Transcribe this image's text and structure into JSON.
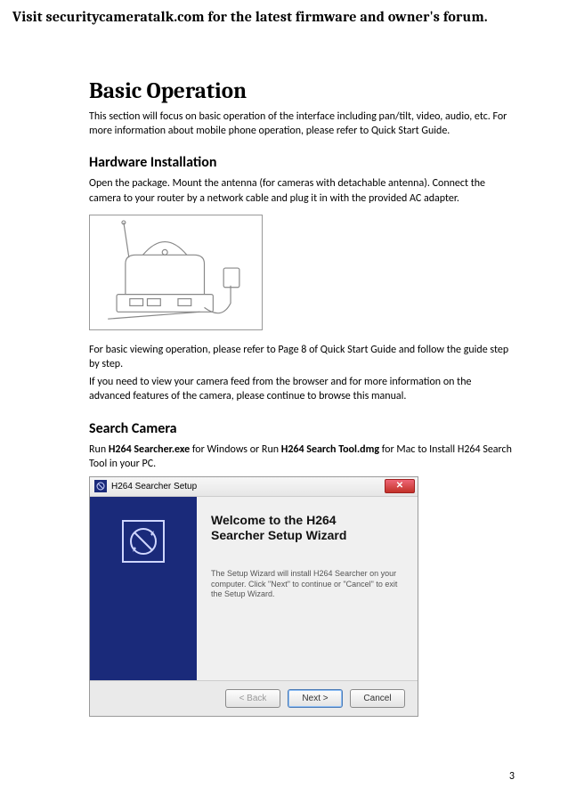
{
  "header": {
    "banner": "Visit securitycameratalk.com for the latest firmware and owner's forum."
  },
  "page": {
    "number": "3"
  },
  "main_title": "Basic Operation",
  "intro_p1": "This section will focus on basic operation of the interface including pan/tilt, video, audio, etc. For more information about mobile phone operation, please refer to Quick Start Guide.",
  "hardware": {
    "title": "Hardware Installation",
    "p1": "Open the package. Mount the antenna (for cameras with detachable antenna). Connect the camera to your router by a network cable and plug it in with the provided AC adapter.",
    "p_after1": "For basic viewing operation, please refer to Page 8 of Quick Start Guide and follow the guide step by step.",
    "p_after2": "If you need to view your camera feed from the browser and for more information on the advanced features of the camera, please continue to browse this manual."
  },
  "search_camera": {
    "title": "Search Camera",
    "run_prefix": "Run ",
    "exe_win": "H264 Searcher.exe",
    "mid1": " for Windows or Run ",
    "exe_mac": "H264 Search Tool.dmg",
    "mid2": " for Mac to Install H264 Search Tool in your PC."
  },
  "wizard": {
    "window_title": "H264 Searcher Setup",
    "welcome_line1": "Welcome to the H264",
    "welcome_line2": "Searcher Setup Wizard",
    "desc": "The Setup Wizard will install H264 Searcher on your computer. Click \"Next\" to continue or \"Cancel\" to exit the Setup Wizard.",
    "btn_back": "< Back",
    "btn_next": "Next >",
    "btn_cancel": "Cancel"
  }
}
